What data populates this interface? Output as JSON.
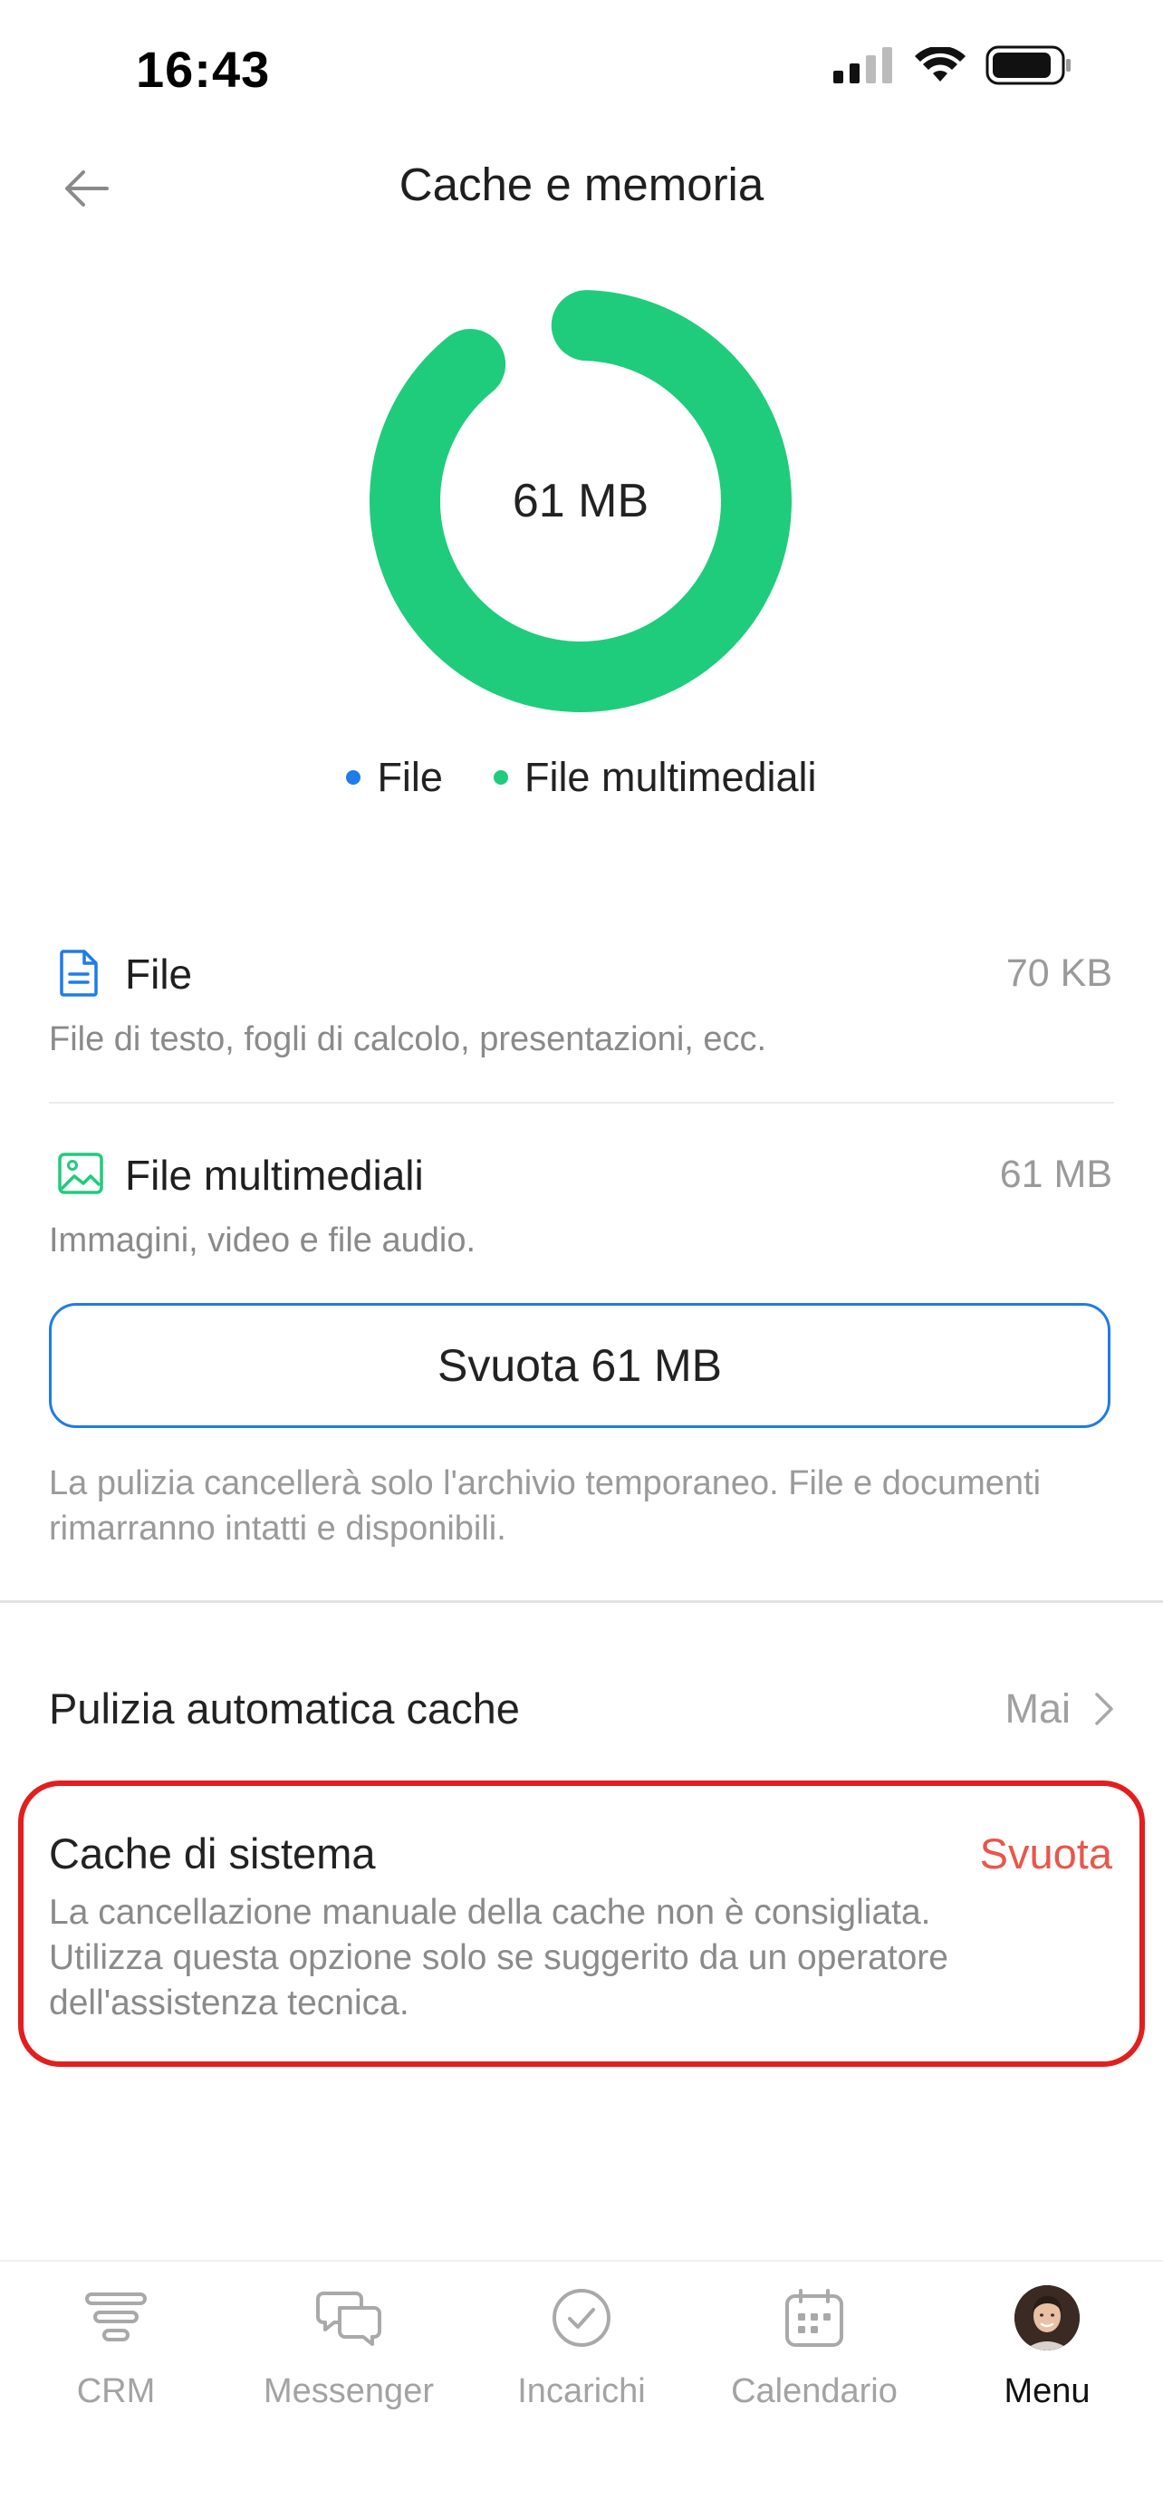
{
  "status_bar": {
    "time": "16:43"
  },
  "header": {
    "title": "Cache e memoria"
  },
  "donut": {
    "center_label": "61 MB",
    "colors": {
      "file": "#1e7bea",
      "media": "#1fcc7c"
    }
  },
  "legend": [
    {
      "label": "File",
      "color": "#1e7bea"
    },
    {
      "label": "File multimediali",
      "color": "#1fcc7c"
    }
  ],
  "storage": {
    "file": {
      "title": "File",
      "size": "70 KB",
      "description": "File di testo, fogli di calcolo, presentazioni, ecc."
    },
    "media": {
      "title": "File multimediali",
      "size": "61 MB",
      "description": "Immagini, video e file audio."
    }
  },
  "clear_button": {
    "label": "Svuota 61 MB"
  },
  "clear_note": "La pulizia cancellerà solo l'archivio temporaneo. File e documenti rimarranno intatti e disponibili.",
  "auto_clean": {
    "label": "Pulizia automatica cache",
    "value": "Mai"
  },
  "system_cache": {
    "title": "Cache di sistema",
    "action": "Svuota",
    "description": "La cancellazione manuale della cache non è consigliata. Utilizza questa opzione solo se suggerito da un operatore dell'assistenza tecnica."
  },
  "tabbar": {
    "items": [
      {
        "label": "CRM",
        "icon": "crm-funnel-icon"
      },
      {
        "label": "Messenger",
        "icon": "chat-bubbles-icon"
      },
      {
        "label": "Incarichi",
        "icon": "check-circle-icon"
      },
      {
        "label": "Calendario",
        "icon": "calendar-icon"
      },
      {
        "label": "Menu",
        "icon": "avatar"
      }
    ],
    "active": "Menu"
  },
  "colors": {
    "accent": "#1e7bea",
    "danger": "#e31e1e",
    "action_red": "#e9564b",
    "green": "#1fcc7c"
  }
}
